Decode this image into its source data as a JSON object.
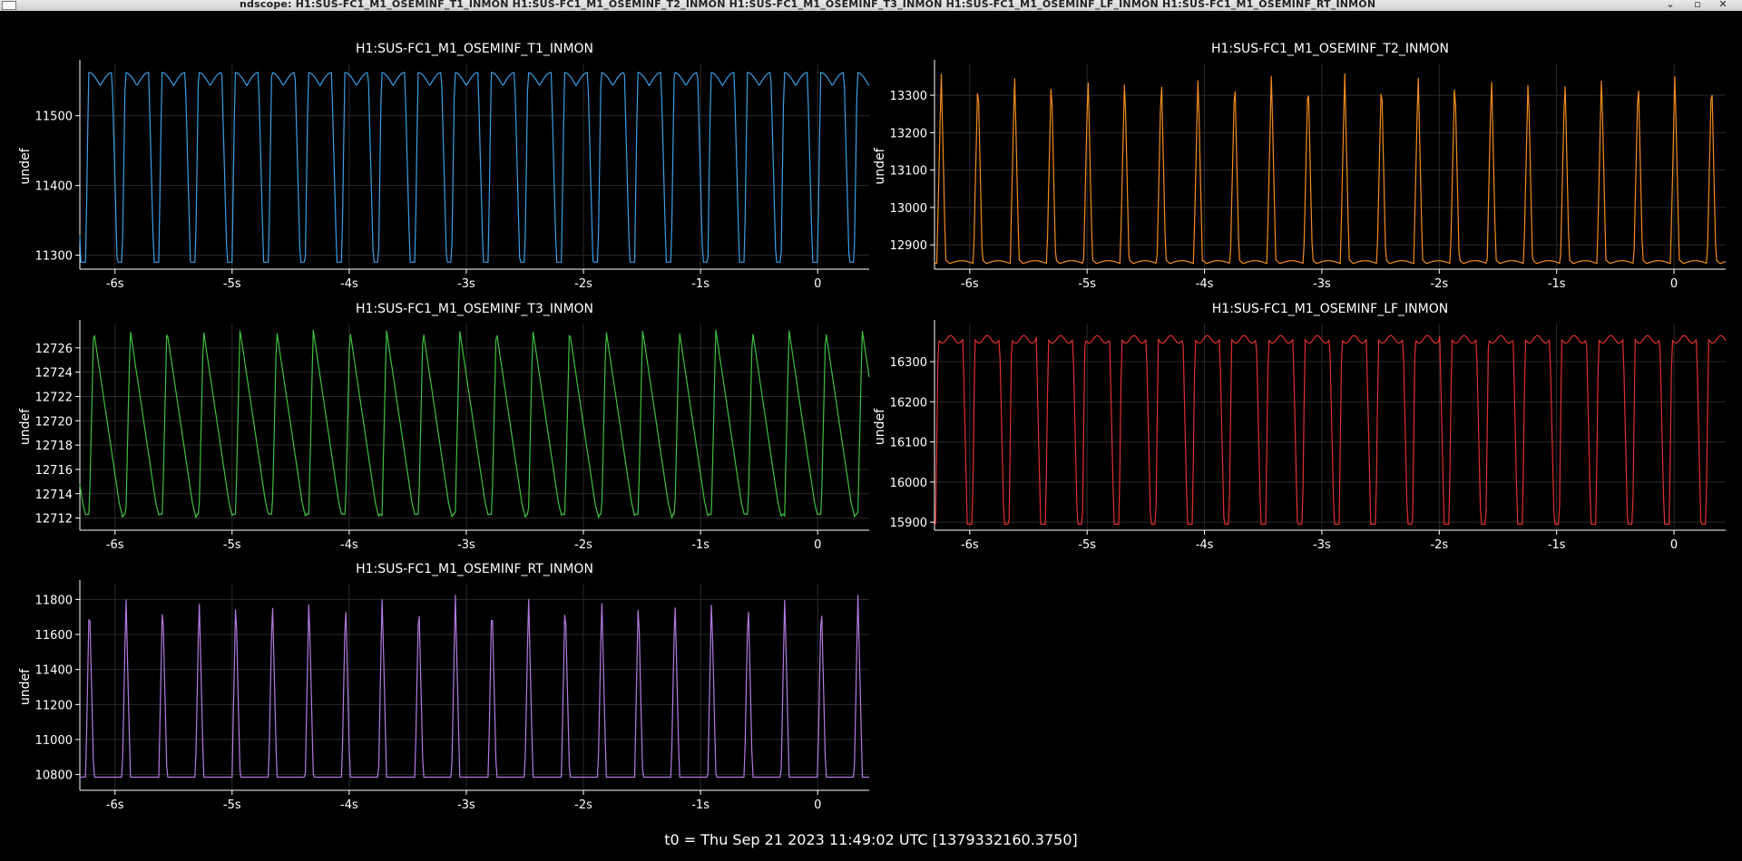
{
  "window": {
    "title": "ndscope: H1:SUS-FC1_M1_OSEMINF_T1_INMON H1:SUS-FC1_M1_OSEMINF_T2_INMON H1:SUS-FC1_M1_OSEMINF_T3_INMON H1:SUS-FC1_M1_OSEMINF_LF_INMON H1:SUS-FC1_M1_OSEMINF_RT_INMON",
    "minimize_glyph": "⌄",
    "maximize_glyph": "▫",
    "close_glyph": "✕",
    "icon": "app-window-icon"
  },
  "footer": {
    "t0_text": "t0 = Thu Sep 21 2023 11:49:02 UTC [1379332160.3750]"
  },
  "colors": {
    "background": "#000000",
    "axis": "#ffffff",
    "grid": "#2a2a2a"
  },
  "chart_data": [
    {
      "type": "line",
      "title": "H1:SUS-FC1_M1_OSEMINF_T1_INMON",
      "ylabel": "undef",
      "xlabel": "",
      "color": "#3a9ee6",
      "grid": true,
      "xlim": [
        -6.3,
        0.44
      ],
      "ylim": [
        11280,
        11575
      ],
      "xticks": [
        -6,
        -5,
        -4,
        -3,
        -2,
        -1,
        0
      ],
      "xtick_labels": [
        "-6s",
        "-5s",
        "-4s",
        "-3s",
        "-2s",
        "-1s",
        "0"
      ],
      "yticks": [
        11300,
        11400,
        11500
      ],
      "ytick_labels": [
        "11300",
        "11400",
        "11500"
      ],
      "waveform": {
        "period_s": 0.3125,
        "min": 11290,
        "max": 11562,
        "shape": "t1",
        "phase_s": -6.25
      }
    },
    {
      "type": "line",
      "title": "H1:SUS-FC1_M1_OSEMINF_T2_INMON",
      "ylabel": "undef",
      "xlabel": "",
      "color": "#f28c1e",
      "grid": true,
      "xlim": [
        -6.3,
        0.44
      ],
      "ylim": [
        12835,
        13385
      ],
      "xticks": [
        -6,
        -5,
        -4,
        -3,
        -2,
        -1,
        0
      ],
      "xtick_labels": [
        "-6s",
        "-5s",
        "-4s",
        "-3s",
        "-2s",
        "-1s",
        "0"
      ],
      "yticks": [
        12900,
        13000,
        13100,
        13200,
        13300
      ],
      "ytick_labels": [
        "12900",
        "13000",
        "13100",
        "13200",
        "13300"
      ],
      "waveform": {
        "period_s": 0.3125,
        "min": 12850,
        "max": 13360,
        "shape": "t2",
        "phase_s": -6.28
      }
    },
    {
      "type": "line",
      "title": "H1:SUS-FC1_M1_OSEMINF_T3_INMON",
      "ylabel": "undef",
      "xlabel": "",
      "color": "#3fbf3f",
      "grid": true,
      "xlim": [
        -6.3,
        0.44
      ],
      "ylim": [
        12711,
        12728
      ],
      "xticks": [
        -6,
        -5,
        -4,
        -3,
        -2,
        -1,
        0
      ],
      "xtick_labels": [
        "-6s",
        "-5s",
        "-4s",
        "-3s",
        "-2s",
        "-1s",
        "0"
      ],
      "yticks": [
        12712,
        12714,
        12716,
        12718,
        12720,
        12722,
        12724,
        12726
      ],
      "ytick_labels": [
        "12712",
        "12714",
        "12716",
        "12718",
        "12720",
        "12722",
        "12724",
        "12726"
      ],
      "waveform": {
        "period_s": 0.3125,
        "min": 12712,
        "max": 12727.5,
        "shape": "t3",
        "phase_s": -6.22
      }
    },
    {
      "type": "line",
      "title": "H1:SUS-FC1_M1_OSEMINF_LF_INMON",
      "ylabel": "undef",
      "xlabel": "",
      "color": "#e03030",
      "grid": true,
      "xlim": [
        -6.3,
        0.44
      ],
      "ylim": [
        15880,
        16395
      ],
      "xticks": [
        -6,
        -5,
        -4,
        -3,
        -2,
        -1,
        0
      ],
      "xtick_labels": [
        "-6s",
        "-5s",
        "-4s",
        "-3s",
        "-2s",
        "-1s",
        "0"
      ],
      "yticks": [
        15900,
        16000,
        16100,
        16200,
        16300
      ],
      "ytick_labels": [
        "15900",
        "16000",
        "16100",
        "16200",
        "16300"
      ],
      "waveform": {
        "period_s": 0.3125,
        "min": 15895,
        "max": 16365,
        "shape": "lf",
        "phase_s": -6.29
      }
    },
    {
      "type": "line",
      "title": "H1:SUS-FC1_M1_OSEMINF_RT_INMON",
      "ylabel": "undef",
      "xlabel": "",
      "color": "#b27ae0",
      "grid": true,
      "xlim": [
        -6.3,
        0.44
      ],
      "ylim": [
        10710,
        11890
      ],
      "xticks": [
        -6,
        -5,
        -4,
        -3,
        -2,
        -1,
        0
      ],
      "xtick_labels": [
        "-6s",
        "-5s",
        "-4s",
        "-3s",
        "-2s",
        "-1s",
        "0"
      ],
      "yticks": [
        10800,
        11000,
        11200,
        11400,
        11600,
        11800
      ],
      "ytick_labels": [
        "10800",
        "11000",
        "11200",
        "11400",
        "11600",
        "11800"
      ],
      "waveform": {
        "period_s": 0.3125,
        "min": 10785,
        "max": 11825,
        "shape": "rt",
        "phase_s": -6.25
      }
    }
  ]
}
